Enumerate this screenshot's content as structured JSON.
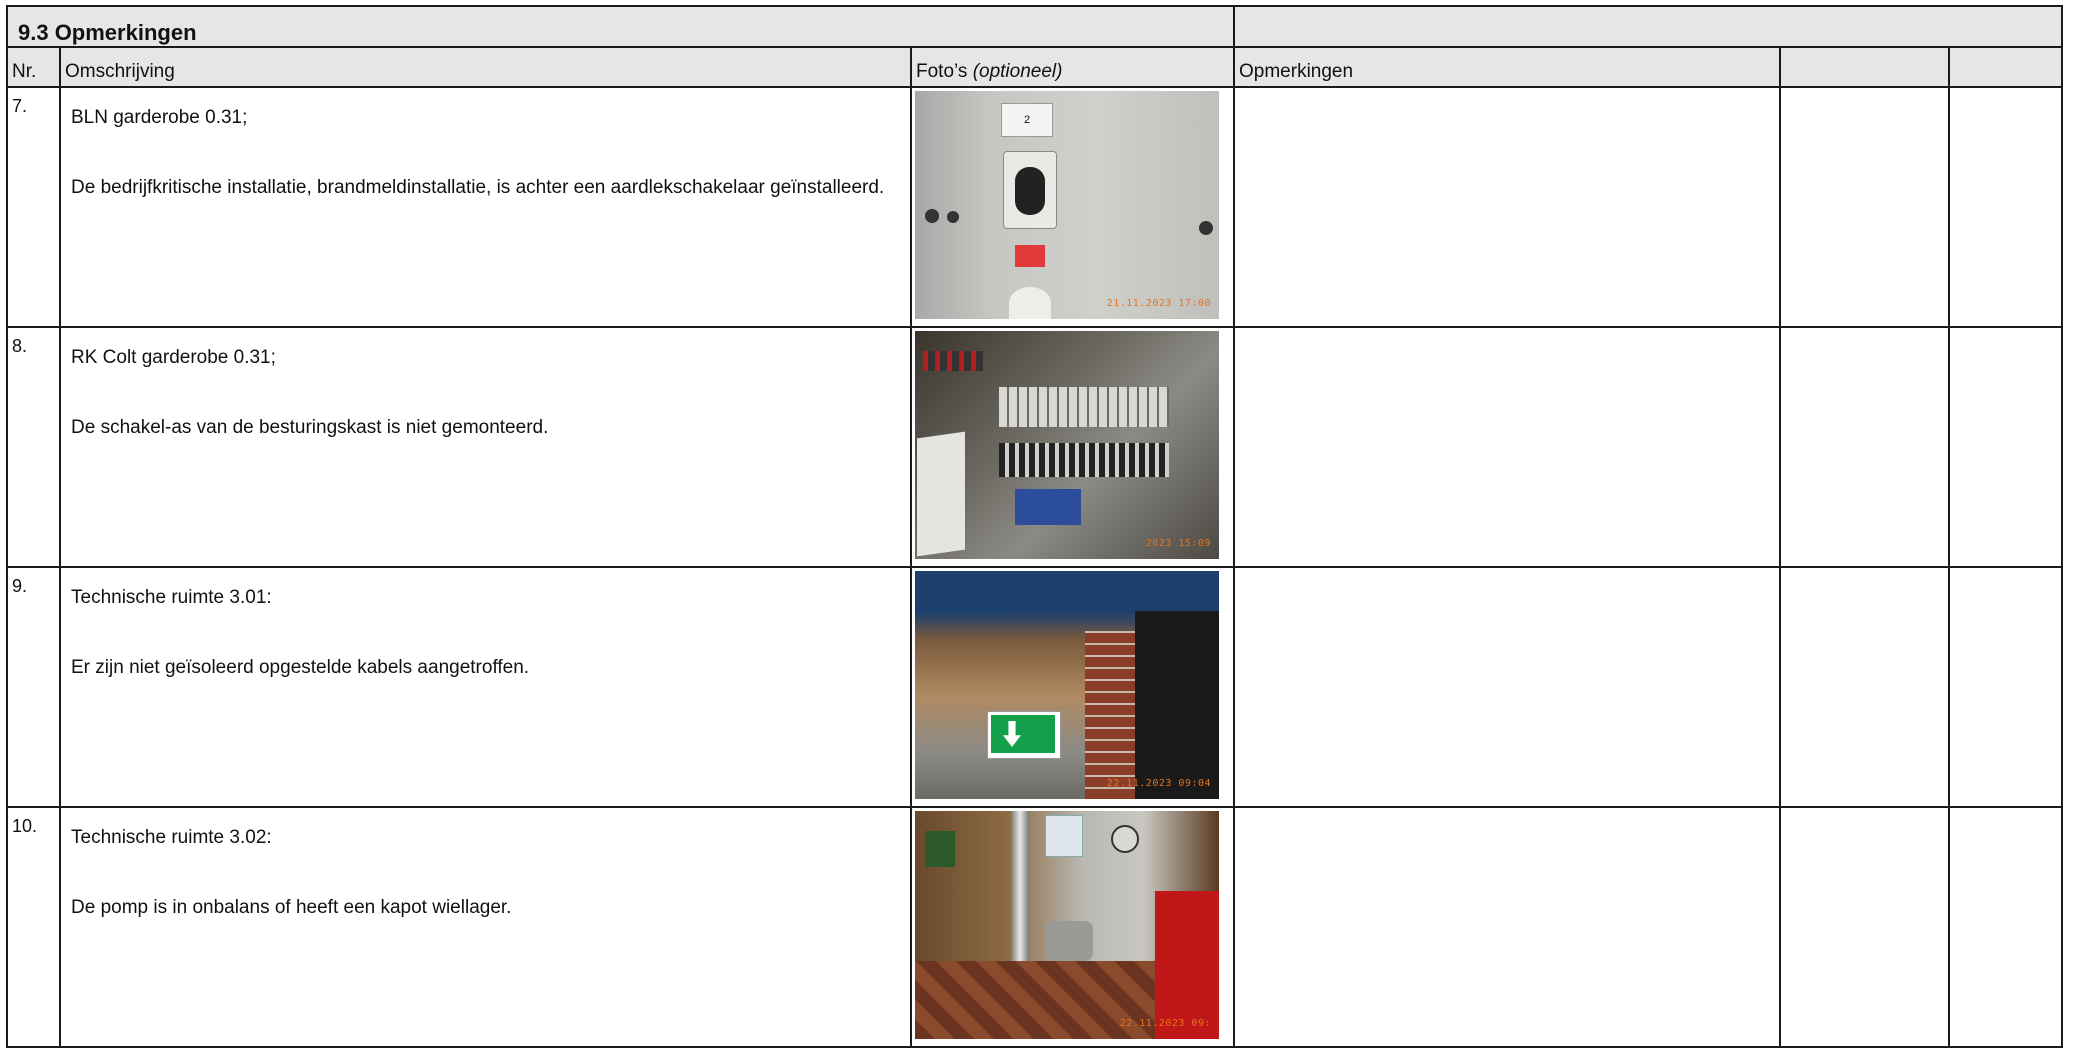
{
  "section": {
    "title": "9.3 Opmerkingen"
  },
  "headers": {
    "nr": "Nr.",
    "description": "Omschrijving",
    "photos_main": "Foto’s ",
    "photos_optional": "(optioneel)",
    "remarks": "Opmerkingen"
  },
  "rows": [
    {
      "nr": "7.",
      "line1": "BLN garderobe 0.31;",
      "line2": "De bedrijfkritische installatie, brandmeldinstallatie, is achter een aardlekschakelaar geïnstalleerd.",
      "photo_stamp": "21.11.2023 17:00",
      "photo_label": "2"
    },
    {
      "nr": "8.",
      "line1": "RK Colt garderobe 0.31;",
      "line2": "De schakel-as van de besturingskast is niet gemonteerd.",
      "photo_stamp": "2023 15:09"
    },
    {
      "nr": "9.",
      "line1": "Technische ruimte 3.01:",
      "line2": "Er zijn niet geïsoleerd opgestelde kabels aangetroffen.",
      "photo_stamp": "22.11.2023 09:04"
    },
    {
      "nr": "10.",
      "line1": "Technische ruimte 3.02:",
      "line2": "De pomp is in onbalans of heeft een kapot wiellager.",
      "photo_stamp": "22.11.2023 09:"
    }
  ]
}
